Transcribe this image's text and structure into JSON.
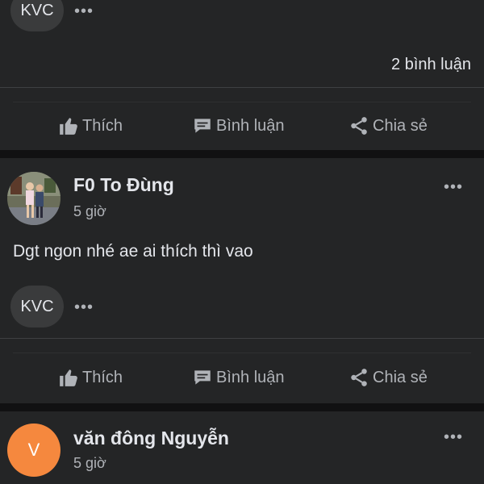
{
  "post_top": {
    "reaction_chip": "KVC",
    "more_label": "•••",
    "comments_count": "2 bình luận",
    "actions": {
      "like": "Thích",
      "comment": "Bình luận",
      "share": "Chia sẻ"
    }
  },
  "post_middle": {
    "author": "F0 To Đùng",
    "time": "5 giờ",
    "text": "Dgt ngon nhé ae ai thích thì vao",
    "reaction_chip": "KVC",
    "more_label": "•••",
    "actions": {
      "like": "Thích",
      "comment": "Bình luận",
      "share": "Chia sẻ"
    }
  },
  "post_bottom": {
    "author": "văn đông Nguyễn",
    "avatar_letter": "V",
    "time": "5 giờ"
  },
  "colors": {
    "background": "#111112",
    "card": "#242526",
    "avatar_orange": "#f5883e"
  },
  "icons": [
    "thumbs-up-icon",
    "comment-icon",
    "share-icon",
    "more-icon"
  ]
}
